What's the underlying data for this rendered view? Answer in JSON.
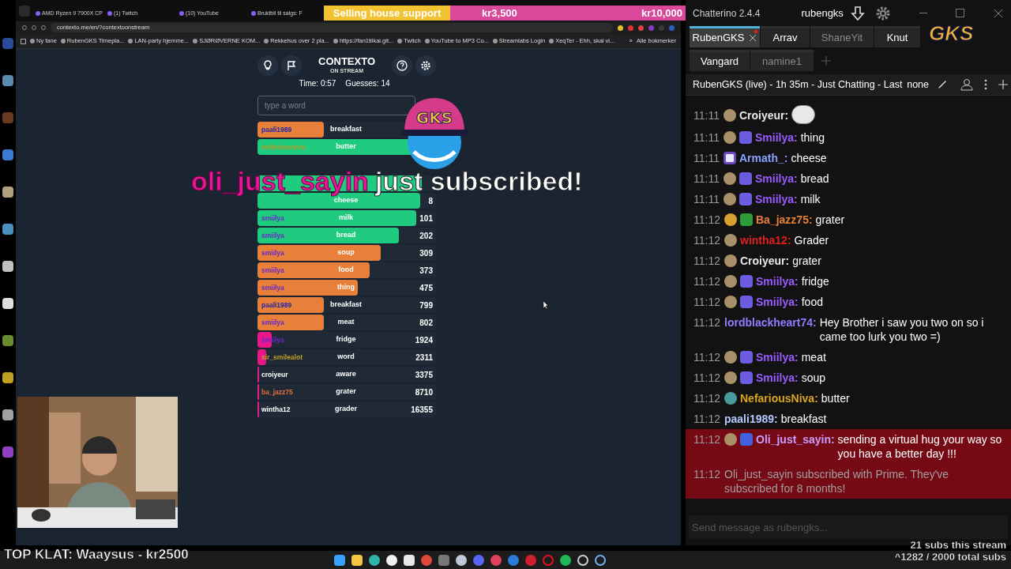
{
  "browser": {
    "tabs": [
      {
        "label": "AMD Ryzen 9 7900X CP"
      },
      {
        "label": "(1) Twitch"
      },
      {
        "label": "(10) YouTube"
      },
      {
        "label": "Bruktbil til salgs: F"
      }
    ],
    "url": "contexto.me/en/?contextoonstream",
    "bookmarks": [
      "Ny fane",
      "RubenGKS Timepla...",
      "LAN-party hjemme...",
      "SJØRØVERNE KOM...",
      "Rekkehus over 2 pla...",
      "https://fan1tilkai.git...",
      "Twitch",
      "YouTube to MP3 Co...",
      "Streamlabs Login",
      "XeqTer - Ehh, skal vi..."
    ],
    "bookmarks_more": "»",
    "all_bookmarks": "Alle bokmerker"
  },
  "goal_banner": {
    "title": "Selling house support",
    "current": "kr3,500",
    "target": "kr10,000"
  },
  "game": {
    "title": "CONTEXTO",
    "subtitle": "ON STREAM",
    "time": "Time: 0:57",
    "guesses": "Guesses: 14",
    "input_placeholder": "type a word",
    "latest_guesses": [
      {
        "player": {
          "name": "paali1989",
          "color": "#2424a8"
        },
        "word": "breakfast",
        "level": 0.37,
        "color": "#e8803a"
      },
      {
        "player": {
          "name": "nefariousniva",
          "color": "#b89a20"
        },
        "word": "butter",
        "level": 0.92,
        "color": "#1fcc7f"
      }
    ],
    "ranked_guesses": [
      {
        "level": 0.92,
        "color": "#1fcc7f"
      },
      {
        "word": "cheese",
        "rank": "8",
        "level": 0.91,
        "color": "#1fcc7f"
      },
      {
        "player": {
          "name": "smiilya",
          "color": "#6a28c8"
        },
        "word": "milk",
        "rank": "101",
        "level": 0.89,
        "color": "#1fcc7f"
      },
      {
        "player": {
          "name": "smiilya",
          "color": "#6a28c8"
        },
        "word": "bread",
        "rank": "202",
        "level": 0.79,
        "color": "#1fcc7f"
      },
      {
        "player": {
          "name": "smiilya",
          "color": "#6a28c8"
        },
        "word": "soup",
        "rank": "309",
        "level": 0.69,
        "color": "#e8803a"
      },
      {
        "player": {
          "name": "smiilya",
          "color": "#6a28c8"
        },
        "word": "food",
        "rank": "373",
        "level": 0.63,
        "color": "#e8803a"
      },
      {
        "player": {
          "name": "smiilya",
          "color": "#6a28c8"
        },
        "word": "thing",
        "rank": "475",
        "level": 0.56,
        "color": "#e8803a"
      },
      {
        "player": {
          "name": "paali1989",
          "color": "#2424a8"
        },
        "word": "breakfast",
        "rank": "799",
        "level": 0.37,
        "color": "#e8803a"
      },
      {
        "player": {
          "name": "smiilya",
          "color": "#6a28c8"
        },
        "word": "meat",
        "rank": "802",
        "level": 0.37,
        "color": "#e8803a"
      },
      {
        "player": {
          "name": "smiilya",
          "color": "#6a28c8"
        },
        "word": "fridge",
        "rank": "1924",
        "level": 0.08,
        "color": "#e8178a"
      },
      {
        "player": {
          "name": "sir_smilealot",
          "color": "#c0a020"
        },
        "word": "word",
        "rank": "2311",
        "level": 0.05,
        "color": "#e8178a"
      },
      {
        "player": {
          "name": "croiyeur",
          "color": "#ffffff"
        },
        "word": "aware",
        "rank": "3375",
        "level": 0.01,
        "color": "#e8178a"
      },
      {
        "player": {
          "name": "ba_jazz75",
          "color": "#e07040"
        },
        "word": "grater",
        "rank": "8710",
        "level": 0.01,
        "color": "#e8178a"
      },
      {
        "player": {
          "name": "wintha12",
          "color": "#ffffff"
        },
        "word": "grader",
        "rank": "16355",
        "level": 0.01,
        "color": "#e8178a"
      }
    ]
  },
  "alert": {
    "user": "oli_just_sayin",
    "message": "just subscribed!"
  },
  "mascot": {
    "label": "GKS"
  },
  "top_donor": "TOP KLAT: Waaysus - kr2500",
  "sub_counters": [
    "21 subs this stream",
    "^1282 / 2000 total subs"
  ],
  "chat": {
    "app_title": "Chatterino 2.4.4",
    "account": "rubengks",
    "logo": "GKS",
    "tabs": [
      {
        "label": "RubenGKS",
        "selected": true,
        "dimmed": false
      },
      {
        "label": "Arrav",
        "selected": false,
        "dimmed": false
      },
      {
        "label": "ShaneYit",
        "selected": false,
        "dimmed": true
      },
      {
        "label": "Knut",
        "selected": false,
        "dimmed": false
      }
    ],
    "tabs_row2": [
      {
        "label": "Vangard",
        "selected": false,
        "dimmed": false
      },
      {
        "label": "namine1",
        "selected": false,
        "dimmed": true
      }
    ],
    "channel_header": "RubenGKS (live) - 1h 35m - Just Chatting - Last",
    "header_status": "none",
    "messages": [
      {
        "kind": "chat",
        "time": "11:11",
        "badges": [
          {
            "kind": "shield"
          }
        ],
        "user": {
          "name": "Croiyeur:",
          "color": "#e8e8e8"
        },
        "emote": true,
        "highlighted": false
      },
      {
        "kind": "chat",
        "time": "11:11",
        "badges": [
          {
            "kind": "shield"
          },
          {
            "kind": "tier"
          }
        ],
        "user": {
          "name": "Smiilya:",
          "color": "#9b5cff"
        },
        "text": "thing",
        "highlighted": false
      },
      {
        "kind": "chat",
        "time": "11:11",
        "badges": [
          {
            "kind": "video"
          }
        ],
        "user": {
          "name": "Armath_:",
          "color": "#8aa0ff"
        },
        "text": "cheese",
        "highlighted": false
      },
      {
        "kind": "chat",
        "time": "11:11",
        "badges": [
          {
            "kind": "shield"
          },
          {
            "kind": "tier"
          }
        ],
        "user": {
          "name": "Smiilya:",
          "color": "#9b5cff"
        },
        "text": "bread",
        "highlighted": false
      },
      {
        "kind": "chat",
        "time": "11:11",
        "badges": [
          {
            "kind": "shield"
          },
          {
            "kind": "tier"
          }
        ],
        "user": {
          "name": "Smiilya:",
          "color": "#9b5cff"
        },
        "text": "milk",
        "highlighted": false
      },
      {
        "kind": "chat",
        "time": "11:12",
        "badges": [
          {
            "kind": "gold"
          },
          {
            "kind": "gift"
          }
        ],
        "user": {
          "name": "Ba_jazz75:",
          "color": "#e8803a"
        },
        "text": "grater",
        "highlighted": false
      },
      {
        "kind": "chat",
        "time": "11:12",
        "badges": [
          {
            "kind": "shield"
          }
        ],
        "user": {
          "name": "wintha12:",
          "color": "#e02020"
        },
        "text": "Grader",
        "highlighted": false
      },
      {
        "kind": "chat",
        "time": "11:12",
        "badges": [
          {
            "kind": "shield"
          }
        ],
        "user": {
          "name": "Croiyeur:",
          "color": "#e8e8e8"
        },
        "text": "grater",
        "highlighted": false
      },
      {
        "kind": "chat",
        "time": "11:12",
        "badges": [
          {
            "kind": "shield"
          },
          {
            "kind": "tier"
          }
        ],
        "user": {
          "name": "Smiilya:",
          "color": "#9b5cff"
        },
        "text": "fridge",
        "highlighted": false
      },
      {
        "kind": "chat",
        "time": "11:12",
        "badges": [
          {
            "kind": "shield"
          },
          {
            "kind": "tier"
          }
        ],
        "user": {
          "name": "Smiilya:",
          "color": "#9b5cff"
        },
        "text": "food",
        "highlighted": false
      },
      {
        "kind": "chat",
        "time": "11:12",
        "user": {
          "name": "lordblackheart74:",
          "color": "#8f7dff"
        },
        "text": "Hey Brother i saw you two on so i came too lurk you two =)",
        "highlighted": false
      },
      {
        "kind": "chat",
        "time": "11:12",
        "badges": [
          {
            "kind": "shield"
          },
          {
            "kind": "tier"
          }
        ],
        "user": {
          "name": "Smiilya:",
          "color": "#9b5cff"
        },
        "text": "meat",
        "highlighted": false
      },
      {
        "kind": "chat",
        "time": "11:12",
        "badges": [
          {
            "kind": "shield"
          },
          {
            "kind": "tier"
          }
        ],
        "user": {
          "name": "Smiilya:",
          "color": "#9b5cff"
        },
        "text": "soup",
        "highlighted": false
      },
      {
        "kind": "chat",
        "time": "11:12",
        "badges": [
          {
            "kind": "teal"
          }
        ],
        "user": {
          "name": "NefariousNiva:",
          "color": "#daa520"
        },
        "text": "butter",
        "highlighted": false
      },
      {
        "kind": "chat",
        "time": "11:12",
        "user": {
          "name": "paali1989:",
          "color": "#b4c8ff"
        },
        "text": "breakfast",
        "highlighted": false
      },
      {
        "kind": "chat",
        "time": "11:12",
        "badges": [
          {
            "kind": "shield"
          },
          {
            "kind": "tulip"
          }
        ],
        "user": {
          "name": "Oli_just_sayin:",
          "color": "#c89cff"
        },
        "text": "sending a virtual hug your way so you have a better day !!!",
        "highlighted": true
      },
      {
        "kind": "system",
        "time": "11:12",
        "text": "Oli_just_sayin subscribed with Prime. They've subscribed for 8 months!",
        "highlighted": true
      }
    ],
    "input_placeholder": "Send message as rubengks..."
  }
}
